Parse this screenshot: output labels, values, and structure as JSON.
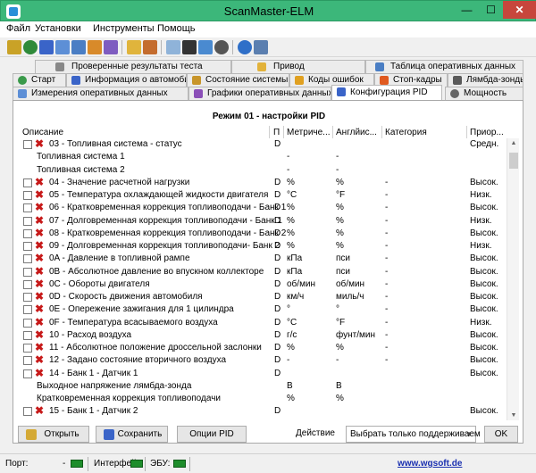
{
  "window": {
    "title": "ScanMaster-ELM"
  },
  "menu": [
    "Файл",
    "Установки",
    "Инструменты",
    "Помощь"
  ],
  "tabs": {
    "row1": [
      "Проверенные результаты теста",
      "Привод",
      "Таблица оперативных данных"
    ],
    "row2": [
      "Старт",
      "Информация о автомобиле",
      "Состояние системы",
      "Коды ошибок",
      "Стоп-кадры",
      "Лямбда-зонды"
    ],
    "row3": [
      "Измерения оперативных данных",
      "Графики оперативных данных",
      "Конфигурация PID",
      "Мощность"
    ],
    "active": "Конфигурация PID"
  },
  "panel": {
    "title": "Режим 01 - настройки PID",
    "columns": [
      "Описание",
      "П",
      "Метриче...",
      "Англйис...",
      "Категория",
      "Приор..."
    ]
  },
  "rows": [
    {
      "checkbox": true,
      "x": true,
      "desc": "03 - Топливная система - статус",
      "p": "D",
      "met": "",
      "eng": "",
      "cat": "",
      "pri": "Средн."
    },
    {
      "checkbox": false,
      "x": false,
      "desc": "Топливная система 1",
      "p": "",
      "met": "-",
      "eng": "-",
      "cat": "",
      "pri": ""
    },
    {
      "checkbox": false,
      "x": false,
      "desc": "Топливная система 2",
      "p": "",
      "met": "-",
      "eng": "-",
      "cat": "",
      "pri": ""
    },
    {
      "checkbox": true,
      "x": true,
      "desc": "04 - Значение расчетной нагрузки",
      "p": "D",
      "met": "%",
      "eng": "%",
      "cat": "-",
      "pri": "Высок."
    },
    {
      "checkbox": true,
      "x": true,
      "desc": "05 - Температура охлаждающей жидкости двигателя",
      "p": "D",
      "met": "°C",
      "eng": "°F",
      "cat": "-",
      "pri": "Низк."
    },
    {
      "checkbox": true,
      "x": true,
      "desc": "06 - Кратковременная коррекция топливоподачи - Банк 1",
      "p": "D",
      "met": "%",
      "eng": "%",
      "cat": "-",
      "pri": "Высок."
    },
    {
      "checkbox": true,
      "x": true,
      "desc": "07 - Долговременная коррекция топливоподачи - Банк 1",
      "p": "D",
      "met": "%",
      "eng": "%",
      "cat": "-",
      "pri": "Низк."
    },
    {
      "checkbox": true,
      "x": true,
      "desc": "08 - Кратковременная коррекция топливоподачи - Банк 2",
      "p": "D",
      "met": "%",
      "eng": "%",
      "cat": "-",
      "pri": "Высок."
    },
    {
      "checkbox": true,
      "x": true,
      "desc": "09 - Долговременная коррекция топливоподачи- Банк 2",
      "p": "D",
      "met": "%",
      "eng": "%",
      "cat": "-",
      "pri": "Низк."
    },
    {
      "checkbox": true,
      "x": true,
      "desc": "0A - Давление в топливной рампе",
      "p": "D",
      "met": "кПа",
      "eng": "пси",
      "cat": "-",
      "pri": "Высок."
    },
    {
      "checkbox": true,
      "x": true,
      "desc": "0B - Абсолютное давление во впускном коллекторе",
      "p": "D",
      "met": "кПа",
      "eng": "пси",
      "cat": "-",
      "pri": "Высок."
    },
    {
      "checkbox": true,
      "x": true,
      "desc": "0C - Обороты двигателя",
      "p": "D",
      "met": "об/мин",
      "eng": "об/мин",
      "cat": "-",
      "pri": "Высок."
    },
    {
      "checkbox": true,
      "x": true,
      "desc": "0D - Скорость движения автомобиля",
      "p": "D",
      "met": "км/ч",
      "eng": "миль/ч",
      "cat": "-",
      "pri": "Высок."
    },
    {
      "checkbox": true,
      "x": true,
      "desc": "0E - Опережение зажигания для 1 цилиндра",
      "p": "D",
      "met": "°",
      "eng": "°",
      "cat": "-",
      "pri": "Высок."
    },
    {
      "checkbox": true,
      "x": true,
      "desc": "0F - Температура всасываемого воздуха",
      "p": "D",
      "met": "°C",
      "eng": "°F",
      "cat": "-",
      "pri": "Низк."
    },
    {
      "checkbox": true,
      "x": true,
      "desc": "10 - Расход воздуха",
      "p": "D",
      "met": "г/с",
      "eng": "фунт/мин",
      "cat": "-",
      "pri": "Высок."
    },
    {
      "checkbox": true,
      "x": true,
      "desc": "11 - Абсолютное положение дроссельной заслонки",
      "p": "D",
      "met": "%",
      "eng": "%",
      "cat": "-",
      "pri": "Высок."
    },
    {
      "checkbox": true,
      "x": true,
      "desc": "12 - Задано состояние вторичного воздуха",
      "p": "D",
      "met": "-",
      "eng": "-",
      "cat": "-",
      "pri": "Высок."
    },
    {
      "checkbox": true,
      "x": true,
      "desc": "14 - Банк 1 - Датчик 1",
      "p": "D",
      "met": "",
      "eng": "",
      "cat": "",
      "pri": "Высок."
    },
    {
      "checkbox": false,
      "x": false,
      "desc": "Выходное напряжение лямбда-зонда",
      "p": "",
      "met": "В",
      "eng": "В",
      "cat": "",
      "pri": ""
    },
    {
      "checkbox": false,
      "x": false,
      "desc": "Кратковременная коррекция топливоподачи",
      "p": "",
      "met": "%",
      "eng": "%",
      "cat": "",
      "pri": ""
    },
    {
      "checkbox": true,
      "x": true,
      "desc": "15 - Банк 1 - Датчик 2",
      "p": "D",
      "met": "",
      "eng": "",
      "cat": "",
      "pri": "Высок."
    }
  ],
  "buttons": {
    "open": "Открыть",
    "save": "Сохранить",
    "pid_options": "Опции PID",
    "ok": "OK"
  },
  "action": {
    "label": "Действие",
    "selected": "Выбрать только поддерживаем"
  },
  "status": {
    "port_label": "Порт:",
    "port_value": "-",
    "interface_label": "Интерфейс:",
    "ecu_label": "ЭБУ:",
    "website": "www.wgsoft.de"
  },
  "colors": {
    "titlebar": "#3cb77a",
    "close": "#c7463c",
    "led": "#1e8d2b",
    "x_mark": "#c71a1a"
  }
}
